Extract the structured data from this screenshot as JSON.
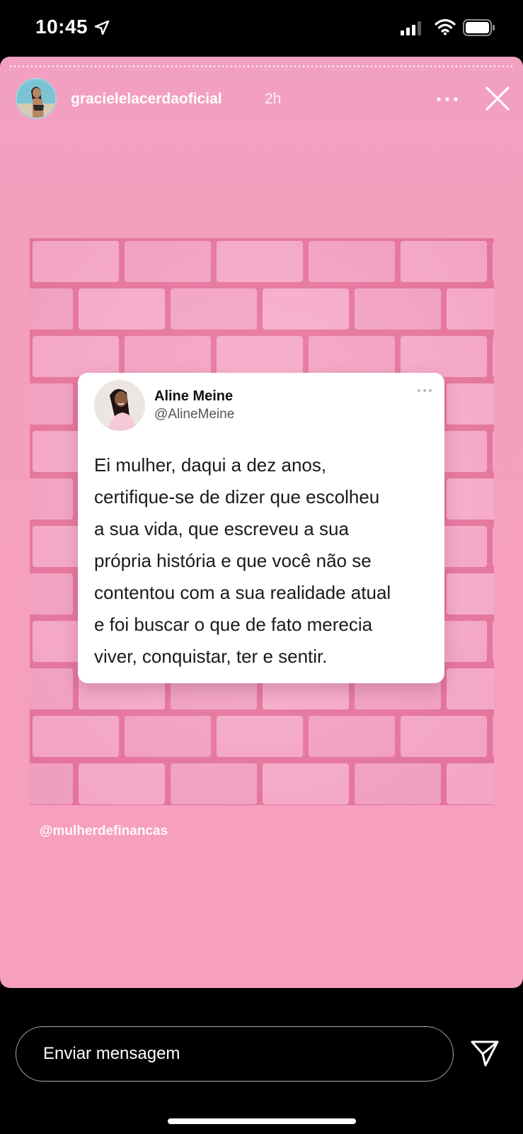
{
  "status_bar": {
    "time": "10:45",
    "icons": [
      "location-arrow-icon",
      "cellular-signal-icon",
      "wifi-icon",
      "battery-icon"
    ]
  },
  "story": {
    "username": "gracielelacerdaoficial",
    "time_ago": "2h",
    "icons": [
      "more-options-icon",
      "close-icon"
    ],
    "background_color": "#f69fbf",
    "credit": "@mulherdefinancas"
  },
  "tweet": {
    "name": "Aline Meine",
    "handle": "@AlineMeine",
    "text": "Ei mulher, daqui a dez anos,\ncertifique-se de dizer que escolheu\na sua vida, que escreveu a sua\nprópria história e que você não se\ncontentou com a sua realidade atual\ne foi buscar o que de fato merecia\nviver, conquistar, ter e sentir."
  },
  "footer": {
    "message_placeholder": "Enviar mensagem",
    "send_icon": "send-icon"
  }
}
